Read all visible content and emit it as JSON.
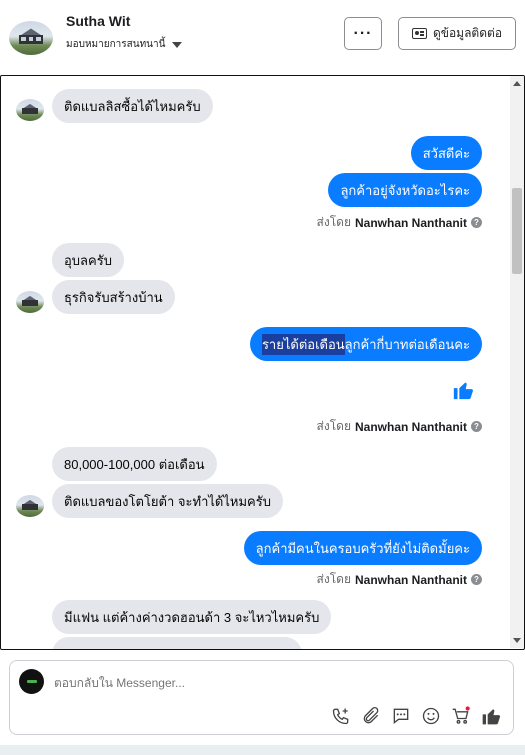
{
  "header": {
    "name": "Sutha Wit",
    "assign": "มอบหมายการสนทนานี้",
    "more_label": "···",
    "info_label": "ดูข้อมูลติดต่อ"
  },
  "messages": [
    {
      "dir": "in",
      "text": "ติดแบลลิสซื้อได้ไหมครับ"
    },
    {
      "dir": "out",
      "text": "สวัสดีค่ะ"
    },
    {
      "dir": "out",
      "text": "ลูกค้าอยู่จังหวัดอะไรคะ"
    },
    {
      "dir": "in",
      "text": "อุบลครับ"
    },
    {
      "dir": "in",
      "text": "ธุรกิจรับสร้างบ้าน"
    },
    {
      "dir": "out",
      "text_hl": "รายได้ต่อเดือน",
      "text_rest": "ลูกค้ากี่บาทต่อเดือนคะ"
    },
    {
      "dir": "in",
      "text": "80,000-100,000 ต่อเดือน"
    },
    {
      "dir": "in",
      "text": "ติดแบลของโตโยต้า จะทำได้ไหมครับ"
    },
    {
      "dir": "out",
      "text": "ลูกค้ามีคนในครอบครัวที่ยังไม่ติดมั้ยคะ"
    },
    {
      "dir": "in",
      "text": "มีแฟน แต่ค้างค่างวดฮอนด้า 3 จะไหวไหมครับ"
    }
  ],
  "sent_by": {
    "prefix": "ส่งโดย",
    "agent": "Nanwhan Nanthanit"
  },
  "composer": {
    "placeholder": "ตอบกลับใน Messenger..."
  },
  "colors": {
    "accent": "#0a7cff",
    "incoming": "#e4e6eb"
  },
  "icons": [
    "phone-add-icon",
    "paperclip-icon",
    "chat-icon",
    "emoji-icon",
    "cart-icon",
    "thumbs-up-icon"
  ]
}
